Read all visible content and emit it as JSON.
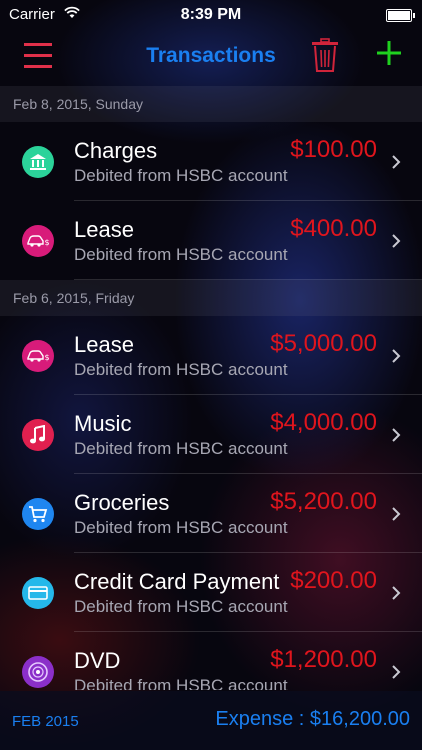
{
  "status": {
    "carrier": "Carrier",
    "time": "8:39 PM"
  },
  "nav": {
    "title": "Transactions"
  },
  "sections": [
    {
      "header": "Feb 8, 2015, Sunday",
      "rows": [
        {
          "title": "Charges",
          "subtitle": "Debited from HSBC account",
          "amount": "$100.00",
          "icon": "bank-icon",
          "color": "#2bd39a"
        },
        {
          "title": "Lease",
          "subtitle": "Debited from HSBC account",
          "amount": "$400.00",
          "icon": "car-lease-icon",
          "color": "#d81b7a"
        }
      ]
    },
    {
      "header": "Feb 6, 2015, Friday",
      "rows": [
        {
          "title": "Lease",
          "subtitle": "Debited from HSBC account",
          "amount": "$5,000.00",
          "icon": "car-lease-icon",
          "color": "#d81b7a"
        },
        {
          "title": "Music",
          "subtitle": "Debited from HSBC account",
          "amount": "$4,000.00",
          "icon": "music-icon",
          "color": "#e0204f"
        },
        {
          "title": "Groceries",
          "subtitle": "Debited from HSBC account",
          "amount": "$5,200.00",
          "icon": "cart-icon",
          "color": "#1f86f0"
        },
        {
          "title": "Credit Card Payment",
          "subtitle": "Debited from HSBC account",
          "amount": "$200.00",
          "icon": "credit-card-icon",
          "color": "#25b8ea"
        },
        {
          "title": "DVD",
          "subtitle": "Debited from HSBC account",
          "amount": "$1,200.00",
          "icon": "dvd-icon",
          "color": "#8b2fc9"
        }
      ]
    }
  ],
  "footer": {
    "month": "FEB 2015",
    "expense": "Expense : $16,200.00"
  }
}
